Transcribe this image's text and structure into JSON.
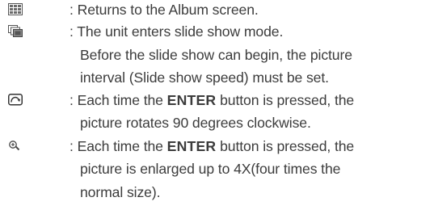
{
  "entries": [
    {
      "icon": "album-grid-icon",
      "separator": ":",
      "lines": [
        "Returns to the Album screen."
      ]
    },
    {
      "icon": "slide-show-icon",
      "separator": ":",
      "lines": [
        "The unit enters slide show mode.",
        "Before the slide show can begin, the picture",
        "interval (Slide show speed) must be set."
      ]
    },
    {
      "icon": "rotate-icon",
      "separator": ":",
      "line1_before": "Each time the ",
      "line1_bold": "ENTER",
      "line1_after": " button is pressed, the",
      "lines": [
        "picture rotates 90 degrees clockwise."
      ]
    },
    {
      "icon": "zoom-icon",
      "separator": ":",
      "line1_before": "Each time the ",
      "line1_bold": "ENTER",
      "line1_after": " button is pressed, the",
      "lines": [
        "picture is enlarged up to 4X(four times the",
        "normal size)."
      ]
    }
  ]
}
